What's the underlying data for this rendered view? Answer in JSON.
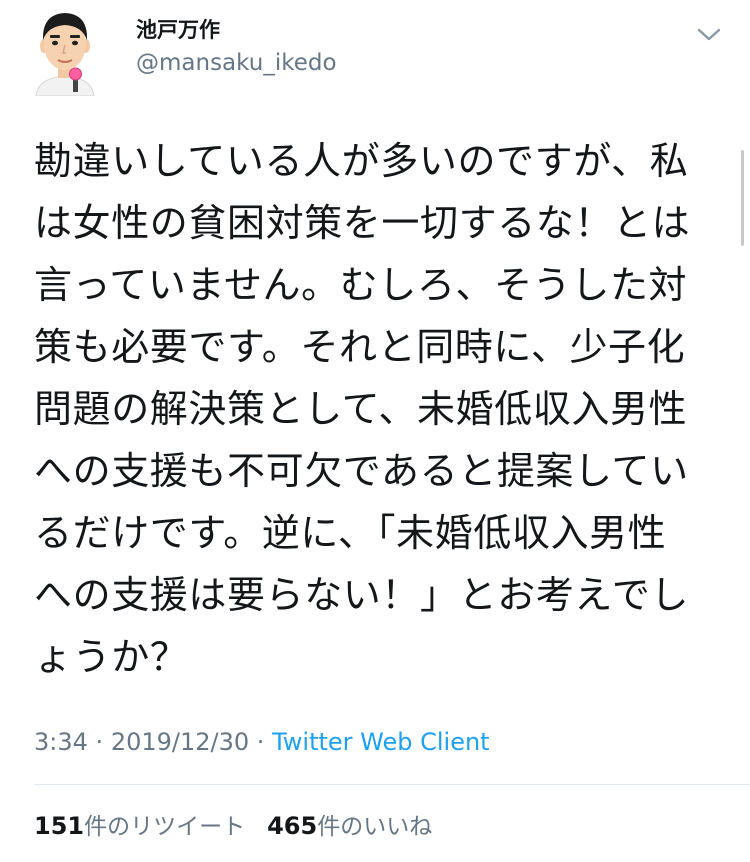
{
  "user": {
    "name": "池戸万作",
    "handle": "@mansaku_ikedo"
  },
  "icons": {
    "avatar": "avatar-illustration",
    "menu": "chevron-down-icon"
  },
  "tweet": {
    "lines": [
      "勘違いしている人が多いのですが、私",
      "は女性の貧困対策を一切するな！とは",
      "言っていません。むしろ、そうした対",
      "策も必要です。それと同時に、少子化",
      "問題の解決策として、未婚低収入男性",
      "への支援も不可欠であると提案してい",
      "るだけです。逆に、「未婚低収入男性",
      "への支援は要らない！」とお考えでし",
      "ょうか？"
    ],
    "time": "3:34",
    "separator": "·",
    "date": "2019/12/30",
    "client": "Twitter Web Client"
  },
  "stats": {
    "retweets_count": "151",
    "retweets_label": "件のリツイート",
    "likes_count": "465",
    "likes_label": "件のいいね"
  },
  "colors": {
    "text": "#14171a",
    "secondary": "#657786",
    "link": "#1da1f2",
    "divider": "#e1e8ed"
  }
}
